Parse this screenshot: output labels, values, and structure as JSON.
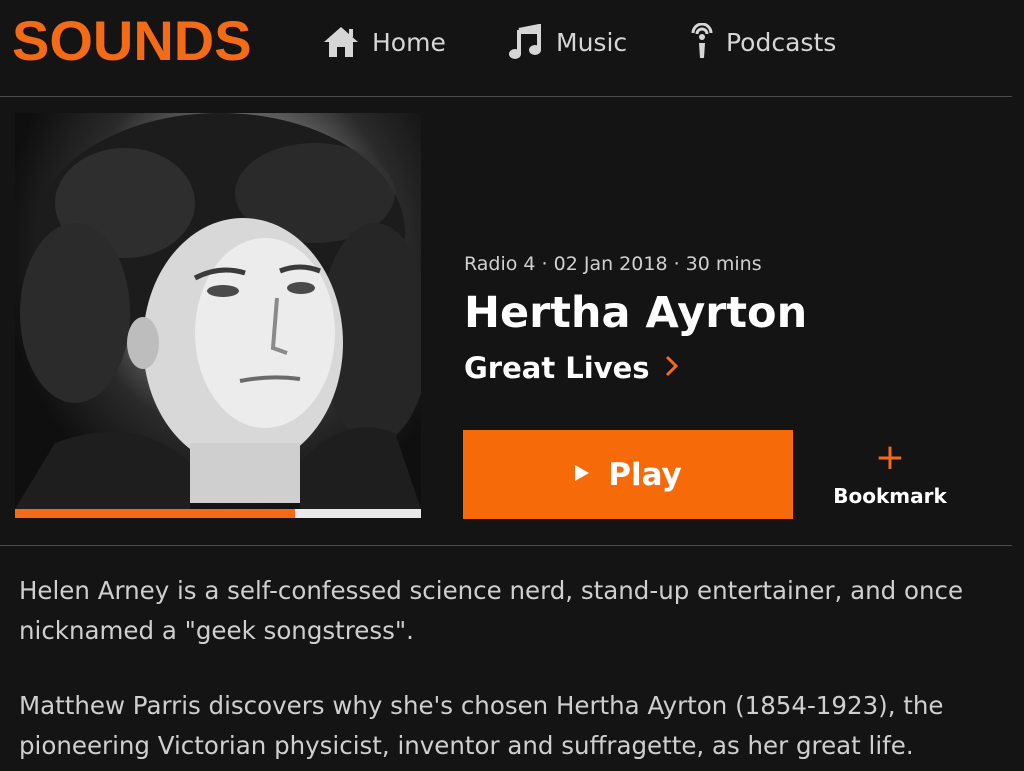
{
  "header": {
    "logo": "SOUNDS",
    "nav": [
      {
        "label": "Home",
        "icon": "home-icon"
      },
      {
        "label": "Music",
        "icon": "music-note-icon"
      },
      {
        "label": "Podcasts",
        "icon": "podcast-icon"
      }
    ]
  },
  "episode": {
    "meta": "Radio 4 · 02 Jan 2018 · 30 mins",
    "title": "Hertha Ayrton",
    "brand": "Great Lives",
    "artwork_alt": "Portrait of Hertha Ayrton",
    "progress_fraction": 0.69
  },
  "actions": {
    "play_label": "Play",
    "bookmark_label": "Bookmark"
  },
  "description": {
    "paragraphs": [
      "Helen Arney is a self-confessed science nerd, stand-up entertainer, and once nicknamed a \"geek songstress\".",
      "Matthew Parris discovers why she's chosen Hertha Ayrton (1854-1923), the pioneering Victorian physicist, inventor and suffragette, as her great life."
    ]
  },
  "colors": {
    "accent": "#f36b17",
    "play_button": "#f66a0a",
    "background": "#141414"
  }
}
